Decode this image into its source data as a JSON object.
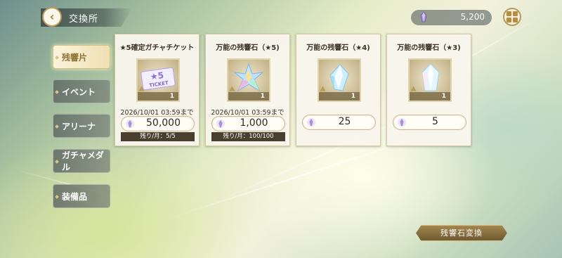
{
  "header": {
    "title": "交換所",
    "currency_value": "5,200"
  },
  "sidebar": {
    "items": [
      {
        "label": "残響片",
        "active": true
      },
      {
        "label": "イベント",
        "active": false
      },
      {
        "label": "アリーナ",
        "active": false
      },
      {
        "label": "ガチャメダル",
        "active": false
      },
      {
        "label": "装備品",
        "active": false
      }
    ]
  },
  "cards": [
    {
      "name": "★5確定ガチャチケット",
      "count": "1",
      "deadline": "2026/10/01 03:59まで",
      "price": "50,000",
      "limit": "残り/月：5/5"
    },
    {
      "name": "万能の残響石（★5)",
      "count": "1",
      "deadline": "2026/10/01 03:59まで",
      "price": "1,000",
      "limit": "残り/月：100/100"
    },
    {
      "name": "万能の残響石（★4)",
      "count": "1",
      "deadline": "",
      "price": "25",
      "limit": ""
    },
    {
      "name": "万能の残響石（★3)",
      "count": "1",
      "deadline": "",
      "price": "5",
      "limit": ""
    }
  ],
  "ticket_art_text": "TICKET",
  "convert_button": "残響石変換",
  "colors": {
    "gold_accent": "#b89a58",
    "crystal_purple": "#9a7fc7"
  },
  "icons": {
    "back": "back-arrow-icon",
    "currency": "purple-crystal-icon",
    "menu": "grid-menu-icon"
  }
}
